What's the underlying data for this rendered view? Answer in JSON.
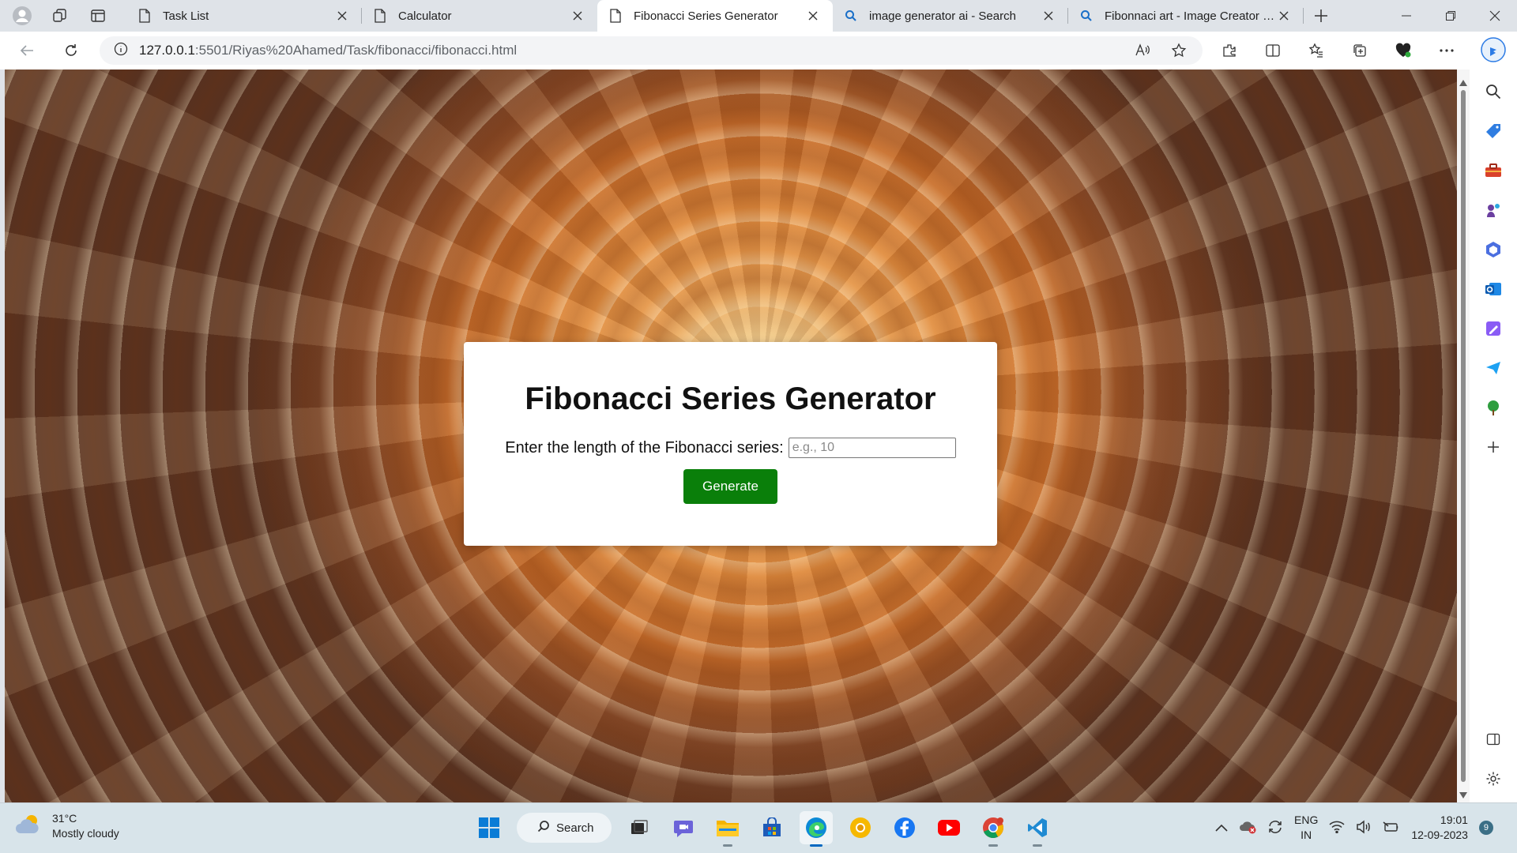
{
  "browser": {
    "tabs": [
      {
        "title": "Task List",
        "icon": "page-icon"
      },
      {
        "title": "Calculator",
        "icon": "page-icon"
      },
      {
        "title": "Fibonacci Series Generator",
        "icon": "page-icon",
        "active": true
      },
      {
        "title": "image generator ai - Search",
        "icon": "search-icon"
      },
      {
        "title": "Fibonnaci art - Image Creator fro",
        "icon": "search-icon"
      }
    ],
    "url_host": "127.0.0.1",
    "url_path": ":5501/Riyas%20Ahamed/Task/fibonacci/fibonacci.html"
  },
  "page": {
    "title": "Fibonacci Series Generator",
    "input_label": "Enter the length of the Fibonacci series:",
    "input_placeholder": "e.g., 10",
    "input_value": "",
    "button_label": "Generate",
    "button_color": "#0a7f0a"
  },
  "taskbar": {
    "weather_temp": "31°C",
    "weather_desc": "Mostly cloudy",
    "search_label": "Search",
    "lang_1": "ENG",
    "lang_2": "IN",
    "time": "19:01",
    "date": "12-09-2023",
    "notification_count": "9"
  },
  "colors": {
    "accent": "#0067c0",
    "tabstrip": "#dfe3e8",
    "taskbar": "#d8e4ea"
  }
}
